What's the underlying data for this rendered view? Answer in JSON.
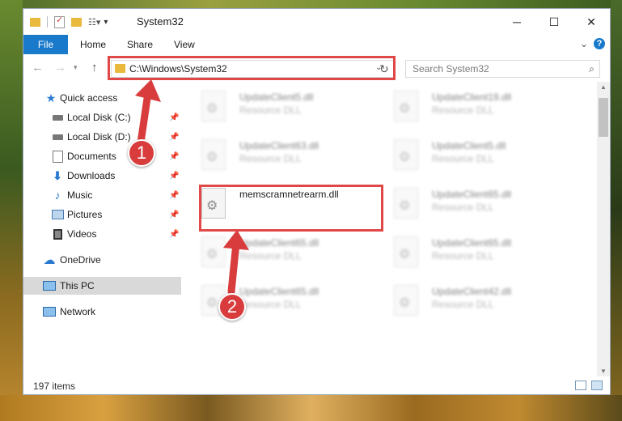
{
  "window": {
    "title": "System32",
    "controls": {
      "minimize": "─",
      "maximize": "☐",
      "close": "✕"
    }
  },
  "ribbon": {
    "file_tab": "File",
    "tabs": [
      "Home",
      "Share",
      "View"
    ]
  },
  "address_bar": {
    "path": "C:\\Windows\\System32"
  },
  "search": {
    "placeholder": "Search System32"
  },
  "sidebar": {
    "quick_access": "Quick access",
    "items": [
      {
        "label": "Local Disk (C:)",
        "pinned": true
      },
      {
        "label": "Local Disk (D:)",
        "pinned": true
      },
      {
        "label": "Documents",
        "pinned": true
      },
      {
        "label": "Downloads",
        "pinned": true
      },
      {
        "label": "Music",
        "pinned": true
      },
      {
        "label": "Pictures",
        "pinned": true
      },
      {
        "label": "Videos",
        "pinned": true
      }
    ],
    "onedrive": "OneDrive",
    "this_pc": "This PC",
    "network": "Network"
  },
  "files": [
    {
      "name": "UpdateClient5.dll",
      "type": "Resource DLL",
      "blurred": true
    },
    {
      "name": "UpdateClient19.dll",
      "type": "Resource DLL",
      "blurred": true
    },
    {
      "name": "UpdateClient63.dll",
      "type": "Resource DLL",
      "blurred": true
    },
    {
      "name": "UpdateClient5.dll",
      "type": "Resource DLL",
      "blurred": true
    },
    {
      "name": "memscramnetrearm.dll",
      "type": "",
      "blurred": false
    },
    {
      "name": "UpdateClient65.dll",
      "type": "Resource DLL",
      "blurred": true
    },
    {
      "name": "UpdateClient65.dll",
      "type": "Resource DLL",
      "blurred": true
    },
    {
      "name": "UpdateClient65.dll",
      "type": "Resource DLL",
      "blurred": true
    },
    {
      "name": "UpdateClient65.dll",
      "type": "Resource DLL",
      "blurred": true
    },
    {
      "name": "UpdateClient42.dll",
      "type": "Resource DLL",
      "blurred": true
    }
  ],
  "status": {
    "item_count": "197 items"
  },
  "annotations": {
    "step1": "1",
    "step2": "2",
    "color": "#e04848"
  }
}
